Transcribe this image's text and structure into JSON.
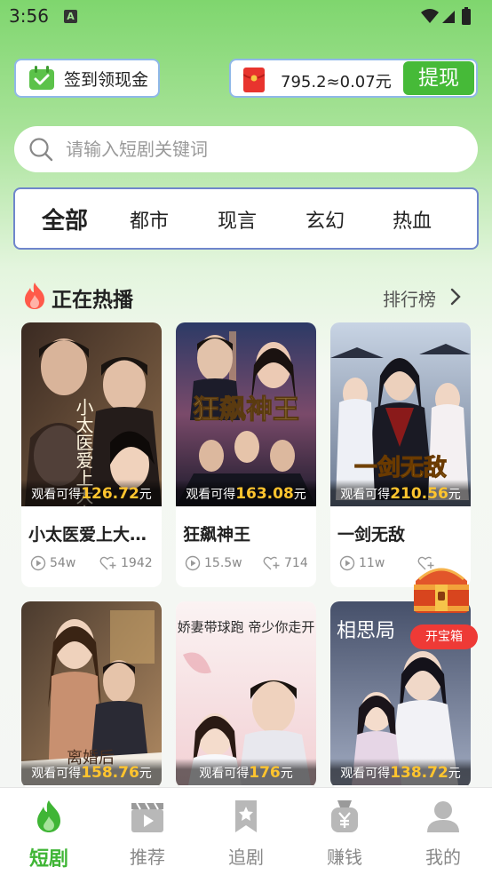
{
  "status_bar": {
    "time": "3:56",
    "notif_letter": "A"
  },
  "signin": {
    "label": "签到领现金",
    "icon": "calendar-check-icon"
  },
  "wallet": {
    "amount": "795.2≈0.07元",
    "withdraw_label": "提现",
    "icon": "red-packet-icon"
  },
  "search": {
    "placeholder": "请输入短剧关键词",
    "value": ""
  },
  "categories": [
    {
      "label": "全部",
      "active": true
    },
    {
      "label": "都市",
      "active": false
    },
    {
      "label": "现言",
      "active": false
    },
    {
      "label": "玄幻",
      "active": false
    },
    {
      "label": "热血",
      "active": false
    }
  ],
  "section": {
    "title": "正在热播",
    "more_label": "排行榜"
  },
  "earn_prefix": "观看可得",
  "earn_suffix": "元",
  "cards": [
    {
      "title": "小太医爱上大…",
      "earn": "126.72",
      "plays": "54w",
      "follows": "1942",
      "poster_text": "小太医爱上大白领"
    },
    {
      "title": "狂飙神王",
      "earn": "163.08",
      "plays": "15.5w",
      "follows": "714",
      "poster_text": "狂飙神王"
    },
    {
      "title": "一剑无敌",
      "earn": "210.56",
      "plays": "11w",
      "follows": "",
      "poster_text": "一剑无敌"
    },
    {
      "earn": "158.76",
      "poster_text": "离婚后"
    },
    {
      "earn": "176",
      "poster_text": "娇妻带球跑 帝少你走开"
    },
    {
      "earn": "138.72",
      "poster_text": "相思局"
    }
  ],
  "treasure": {
    "badge": "开宝箱"
  },
  "nav": [
    {
      "label": "短剧",
      "icon": "flame-icon",
      "active": true
    },
    {
      "label": "推荐",
      "icon": "clapperboard-icon",
      "active": false
    },
    {
      "label": "追剧",
      "icon": "bookmark-star-icon",
      "active": false
    },
    {
      "label": "赚钱",
      "icon": "money-bag-icon",
      "active": false
    },
    {
      "label": "我的",
      "icon": "user-icon",
      "active": false
    }
  ],
  "colors": {
    "accent_green": "#46ba38",
    "earn_yellow": "#ffc42e",
    "badge_red": "#ee3a36"
  }
}
